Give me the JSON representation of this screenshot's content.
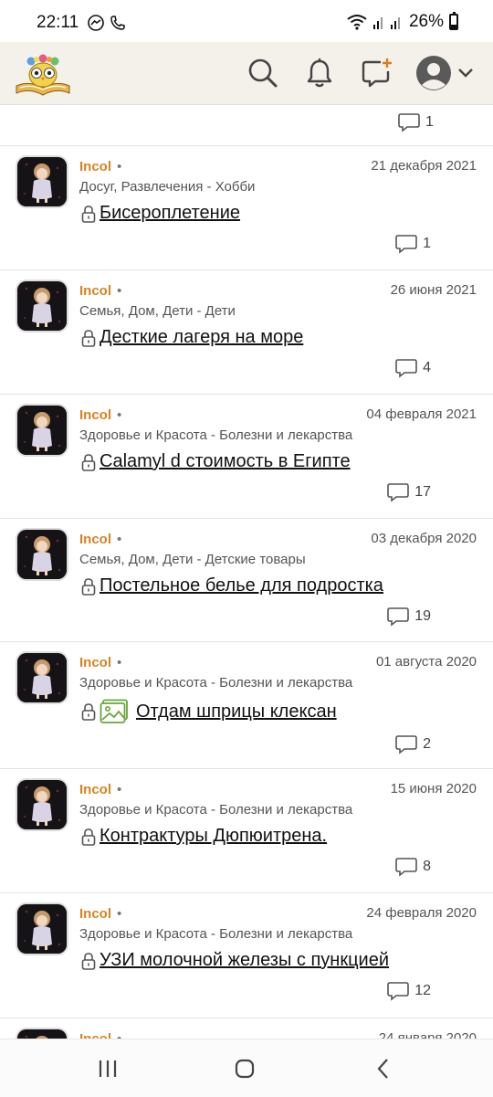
{
  "status_bar": {
    "time": "22:11",
    "battery": "26%"
  },
  "header": {
    "logo_icon": "owl-book-logo",
    "search_icon": "search-icon",
    "bell_icon": "bell-icon",
    "new_post_icon": "add-comment-icon",
    "profile_icon": "profile-icon"
  },
  "top_comment_count": "1",
  "posts": [
    {
      "author": "Incol",
      "date": "21 декабря 2021",
      "category": "Досуг, Развлечения - Хобби",
      "title": "Бисероплетение",
      "comments": "1",
      "has_image": false
    },
    {
      "author": "Incol",
      "date": "26 июня 2021",
      "category": "Семья, Дом, Дети - Дети",
      "title": "Десткие лагеря на море",
      "comments": "4",
      "has_image": false
    },
    {
      "author": "Incol",
      "date": "04 февраля 2021",
      "category": "Здоровье и Красота - Болезни и лекарства",
      "title": "Calamyl d стоимость в Египте",
      "comments": "17",
      "has_image": false
    },
    {
      "author": "Incol",
      "date": "03 декабря 2020",
      "category": "Семья, Дом, Дети - Детские товары",
      "title": "Постельное белье для подростка",
      "comments": "19",
      "has_image": false
    },
    {
      "author": "Incol",
      "date": "01 августа 2020",
      "category": "Здоровье и Красота - Болезни и лекарства",
      "title": "Отдам шприцы клексан",
      "comments": "2",
      "has_image": true
    },
    {
      "author": "Incol",
      "date": "15 июня 2020",
      "category": "Здоровье и Красота - Болезни и лекарства",
      "title": "Контрактуры Дюпюитрена.",
      "comments": "8",
      "has_image": false
    },
    {
      "author": "Incol",
      "date": "24 февраля 2020",
      "category": "Здоровье и Красота - Болезни и лекарства",
      "title": "УЗИ молочной железы с пункцией",
      "comments": "12",
      "has_image": false
    },
    {
      "author": "Incol",
      "date": "24 января 2020",
      "category": "",
      "title": "",
      "comments": "",
      "has_image": false
    }
  ],
  "colors": {
    "accent": "#d88320",
    "header_bg": "#f4f1ea"
  }
}
